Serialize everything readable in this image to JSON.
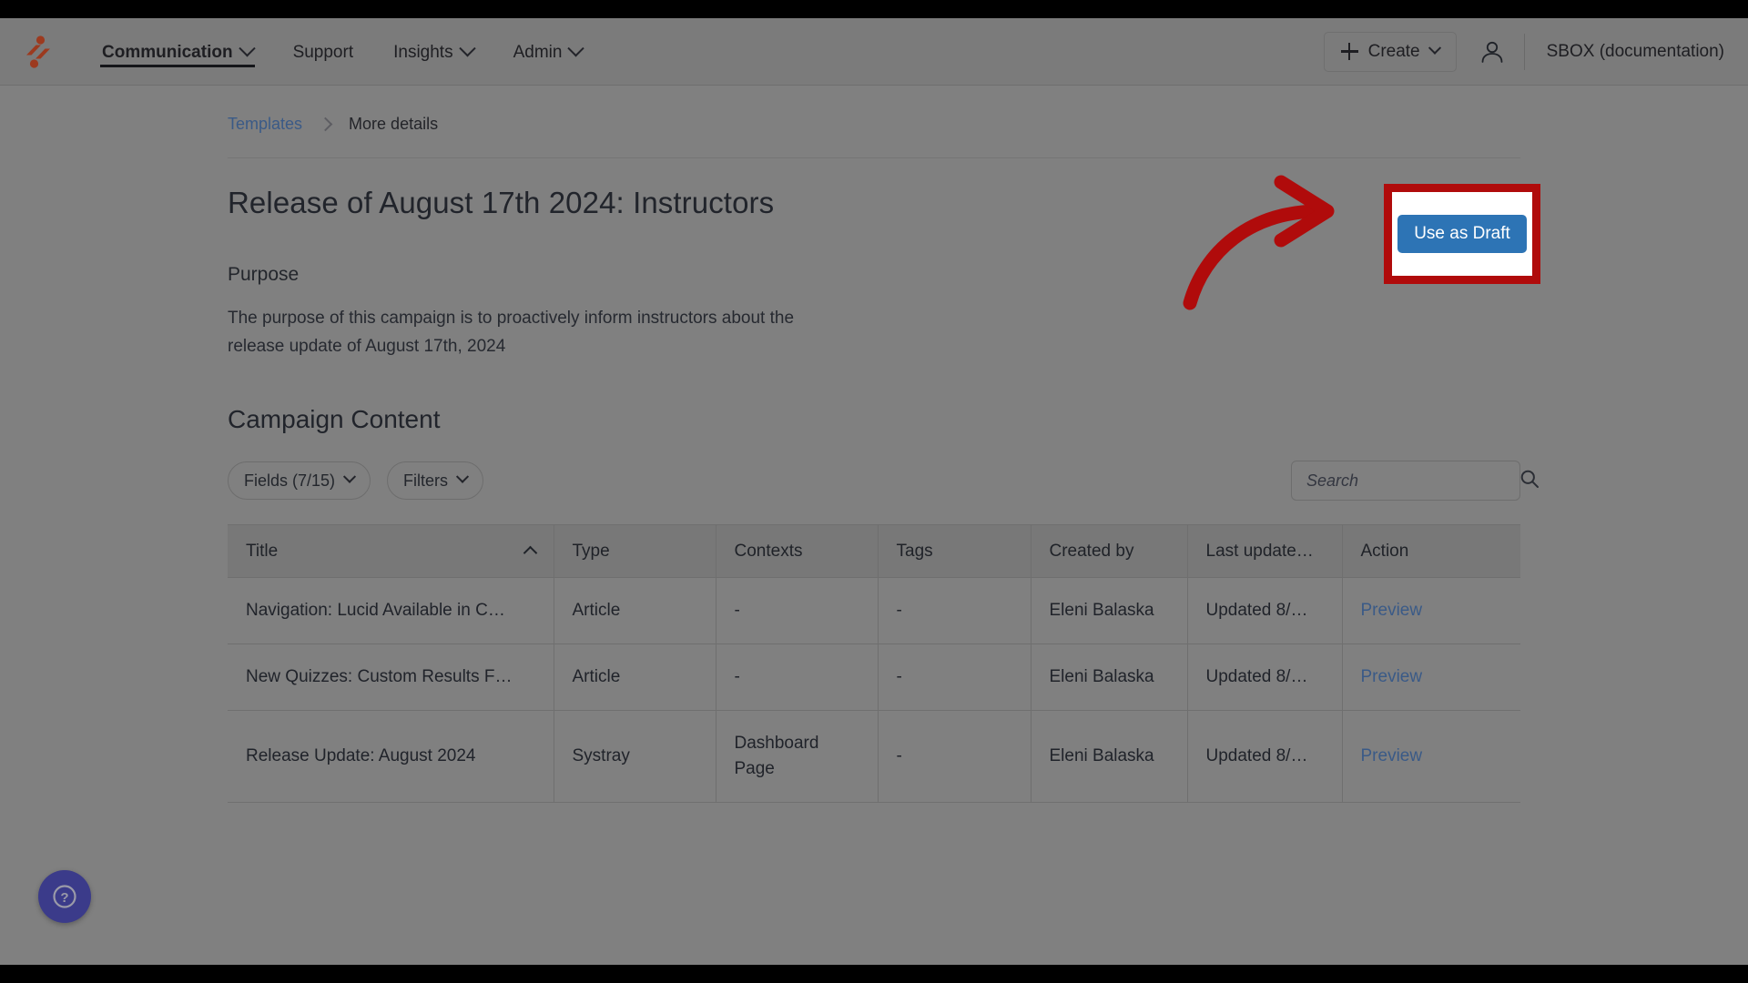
{
  "header": {
    "logo_icon": "instructure-logo-icon",
    "nav": [
      {
        "label": "Communication",
        "has_dropdown": true,
        "active": true
      },
      {
        "label": "Support",
        "has_dropdown": false,
        "active": false
      },
      {
        "label": "Insights",
        "has_dropdown": true,
        "active": false
      },
      {
        "label": "Admin",
        "has_dropdown": true,
        "active": false
      }
    ],
    "create_label": "Create",
    "create_icon": "plus-icon",
    "account_icon": "user-account-icon",
    "account_name": "SBOX (documentation)"
  },
  "breadcrumb": {
    "parent": "Templates",
    "separator_icon": "chevron-right-icon",
    "current": "More details"
  },
  "page": {
    "title": "Release of August 17th 2024: Instructors",
    "purpose_label": "Purpose",
    "purpose_text": "The purpose of this campaign is to proactively inform instructors about the release update of August 17th, 2024",
    "content_heading": "Campaign Content"
  },
  "toolbar": {
    "fields_label": "Fields (7/15)",
    "filters_label": "Filters",
    "dropdown_icon": "chevron-down-icon",
    "search": {
      "placeholder": "Search",
      "value": "",
      "icon": "search-icon"
    }
  },
  "table": {
    "columns": [
      {
        "label": "Title",
        "sorted": "asc",
        "sort_icon": "chevron-up-icon"
      },
      {
        "label": "Type",
        "sorted": null,
        "sort_icon": ""
      },
      {
        "label": "Contexts",
        "sorted": null,
        "sort_icon": ""
      },
      {
        "label": "Tags",
        "sorted": null,
        "sort_icon": ""
      },
      {
        "label": "Created by",
        "sorted": null,
        "sort_icon": ""
      },
      {
        "label": "Last update…",
        "sorted": null,
        "sort_icon": ""
      },
      {
        "label": "Action",
        "sorted": null,
        "sort_icon": ""
      }
    ],
    "rows": [
      {
        "title": "Navigation: Lucid Available in C…",
        "type": "Article",
        "contexts": "-",
        "tags": "-",
        "created_by": "Eleni Balaska",
        "last_updated": "Updated 8/…",
        "action": "Preview"
      },
      {
        "title": "New Quizzes: Custom Results F…",
        "type": "Article",
        "contexts": "-",
        "tags": "-",
        "created_by": "Eleni Balaska",
        "last_updated": "Updated 8/…",
        "action": "Preview"
      },
      {
        "title": "Release Update: August 2024",
        "type": "Systray",
        "contexts": "Dashboard Page",
        "tags": "-",
        "created_by": "Eleni Balaska",
        "last_updated": "Updated 8/…",
        "action": "Preview"
      }
    ]
  },
  "actions": {
    "use_as_draft_label": "Use as Draft"
  },
  "help": {
    "icon": "question-mark-icon",
    "label": "Help"
  },
  "annotation": {
    "highlight_color": "#b00b0b",
    "arrow_color": "#b00b0b",
    "arrow_icon": "curved-arrow-right-icon"
  },
  "colors": {
    "accent_blue": "#2d74b5",
    "link_blue": "#3a5a87",
    "brand_orange": "#9c3a1f",
    "help_purple": "#3b3b8a",
    "page_bg": "#808080",
    "topbar_bg": "#7b7b7b"
  }
}
